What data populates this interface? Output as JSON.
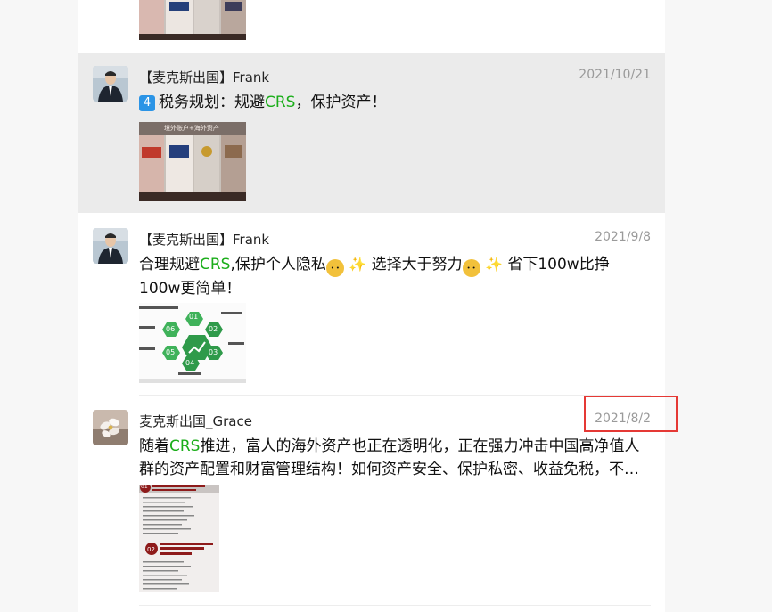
{
  "colors": {
    "crs": "#1aad19",
    "annotation": "#e53935",
    "highlight": "#ebebeb"
  },
  "posts": [
    {
      "author": "【麦克斯出国】Frank",
      "date": "2021/10/21",
      "badge": "4",
      "text_before": "税务规划：规避",
      "crs": "CRS",
      "text_after": "，保护资产！",
      "image_caption": "境外账户+海外资产"
    },
    {
      "author": "【麦克斯出国】Frank",
      "date": "2021/9/8",
      "text_a": "合理规避",
      "crs": "CRS",
      "text_b": ",保护个人隐私",
      "text_c": " 选择大于努力",
      "text_d": " 省下100w比挣100w更简单！",
      "hex_labels": [
        "01",
        "02",
        "03",
        "04",
        "05",
        "06"
      ]
    },
    {
      "author": "麦克斯出国_Grace",
      "date": "2021/8/2",
      "text_a": "随着",
      "crs": "CRS",
      "text_b": "推进，富人的海外资产也正在透明化，正在强力冲击中国高净值人群的资产配置和财富管理结构！如何资产安全、保护私密、收益免税，不…",
      "doc_labels": [
        "01",
        "02"
      ]
    }
  ],
  "icons": {
    "badge": "keycap-4-icon",
    "thinking": "thinking-face-icon",
    "sparkles": "sparkles-icon"
  }
}
